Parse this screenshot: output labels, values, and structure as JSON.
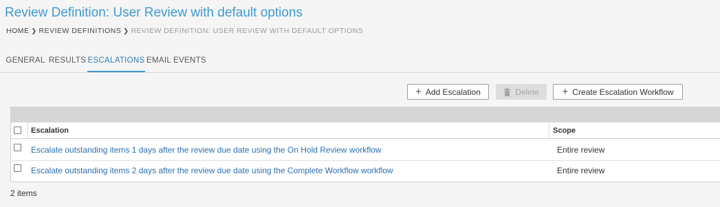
{
  "page": {
    "title": "Review Definition: User Review with default options"
  },
  "breadcrumb": {
    "home": "HOME",
    "review_definitions": "REVIEW DEFINITIONS",
    "current": "REVIEW DEFINITION: USER REVIEW WITH DEFAULT OPTIONS"
  },
  "tabs": [
    {
      "label": "GENERAL"
    },
    {
      "label": "RESULTS"
    },
    {
      "label": "ESCALATIONS"
    },
    {
      "label": "EMAIL EVENTS"
    }
  ],
  "active_tab": "ESCALATIONS",
  "toolbar": {
    "add_label": "Add Escalation",
    "delete_label": "Delete",
    "create_workflow_label": "Create Escalation Workflow"
  },
  "table": {
    "columns": {
      "escalation": "Escalation",
      "scope": "Scope"
    },
    "rows": [
      {
        "escalation": "Escalate outstanding items 1 days after the review due date using the On Hold Review workflow",
        "scope": "Entire review"
      },
      {
        "escalation": "Escalate outstanding items 2 days after the review due date using the Complete Workflow workflow",
        "scope": "Entire review"
      }
    ]
  },
  "footer": {
    "count": "2 items"
  },
  "colors": {
    "accent": "#3e9bd0",
    "link": "#2c6fb0",
    "toolbar_gray": "#d6d6d6"
  },
  "icons": {
    "add": "plus-icon",
    "delete": "trash-icon",
    "breadcrumb_separator": "chevron-right-icon"
  }
}
